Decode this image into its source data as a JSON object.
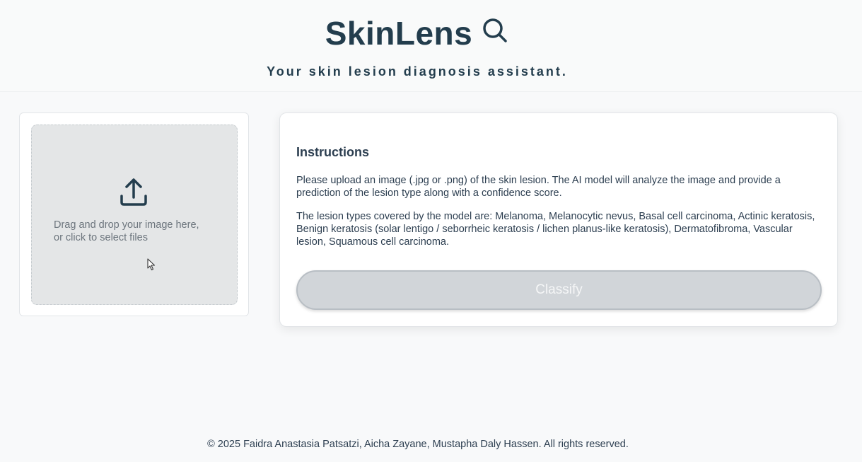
{
  "header": {
    "title": "SkinLens",
    "title_icon": "search-icon",
    "tagline": "Your skin lesion diagnosis assistant."
  },
  "upload": {
    "icon": "upload-icon",
    "line1": "Drag and drop your image here,",
    "line2": "or click to select files"
  },
  "instructions": {
    "title": "Instructions",
    "paragraph1": "Please upload an image (.jpg or .png) of the skin lesion. The AI model will analyze the image and provide a prediction of the lesion type along with a confidence score.",
    "paragraph2": "The lesion types covered by the model are: Melanoma, Melanocytic nevus, Basal cell carcinoma, Actinic keratosis, Benign keratosis (solar lentigo / seborrheic keratosis / lichen planus-like keratosis), Dermatofibroma, Vascular lesion, Squamous cell carcinoma.",
    "classify_label": "Classify"
  },
  "footer": {
    "text": "© 2025 Faidra Anastasia Patsatzi, Aicha Zayane, Mustapha Daly Hassen. All rights reserved."
  },
  "colors": {
    "brand": "#233d4d",
    "background": "#f8f9fa",
    "dropzone": "#e4e6e7",
    "button_disabled": "#d1d5d9"
  }
}
